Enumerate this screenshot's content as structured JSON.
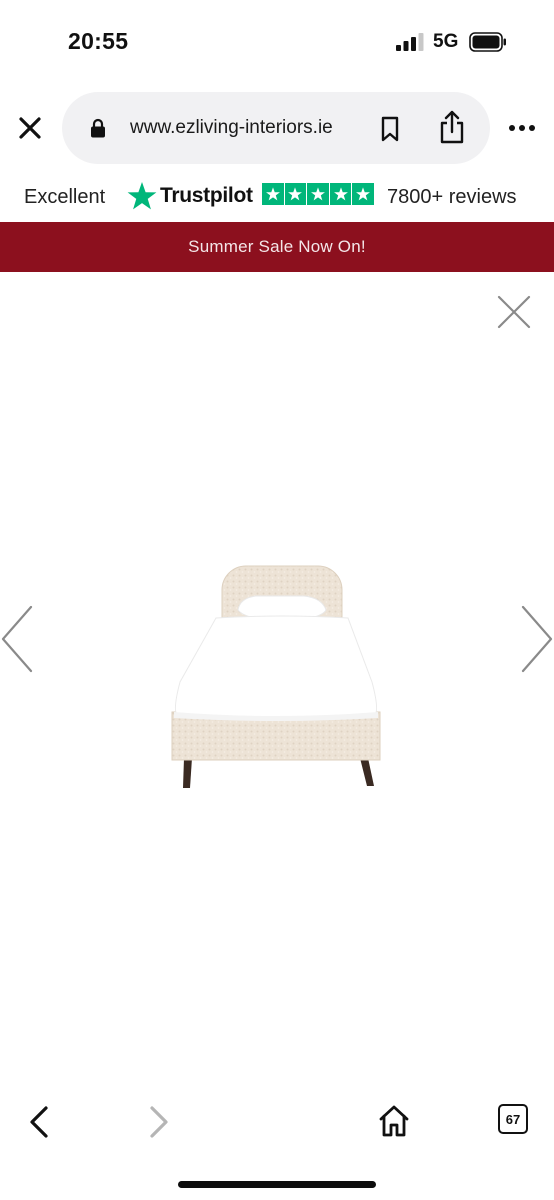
{
  "status_bar": {
    "time": "20:55",
    "network": "5G",
    "signal_bars_active": 3,
    "signal_bars_total": 4,
    "battery_icon": "battery-icon"
  },
  "browser": {
    "url": "www.ezliving-interiors.ie",
    "icons": [
      "close-icon",
      "lock-icon",
      "bookmark-icon",
      "share-icon",
      "more-icon"
    ]
  },
  "trustpilot": {
    "label": "Excellent",
    "brand": "Trustpilot",
    "stars": 5,
    "reviews": "7800+ reviews",
    "color": "#00b67a"
  },
  "banner": {
    "text": "Summer Sale Now On!",
    "color": "#8c101e"
  },
  "gallery": {
    "image_alt": "bed-image",
    "icons": [
      "close-icon",
      "chevron-left-icon",
      "chevron-right-icon"
    ]
  },
  "toolbar": {
    "tab_count": "67",
    "icons": [
      "back-icon",
      "forward-icon",
      "home-icon",
      "tabs-icon"
    ]
  }
}
